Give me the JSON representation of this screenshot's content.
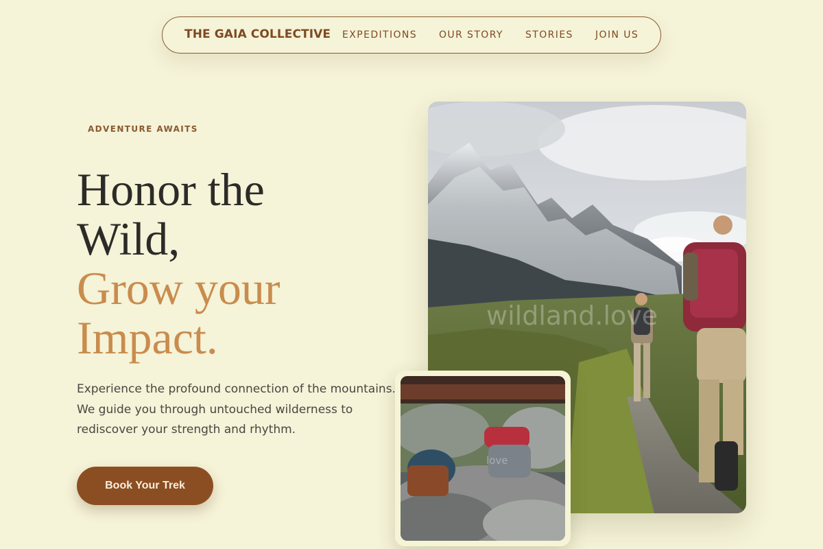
{
  "nav": {
    "brand": "THE GAIA COLLECTIVE",
    "links": [
      "EXPEDITIONS",
      "OUR STORY",
      "STORIES",
      "JOIN US"
    ]
  },
  "hero": {
    "eyebrow": "ADVENTURE AWAITS",
    "headline_dark": [
      "Honor the",
      "Wild,"
    ],
    "headline_accent": [
      "Grow your",
      "Impact."
    ],
    "lede": "Experience the profound connection of the mountains. We guide you through untouched wilderness to rediscover your strength and rhythm.",
    "cta_label": "Book Your Trek"
  },
  "images": {
    "main": {
      "subject": "hikers-on-mountain-trail",
      "watermark": "wildland.love"
    },
    "small": {
      "subject": "backpacks-on-rocks",
      "watermark": "love"
    }
  },
  "colors": {
    "background": "#f5f3d8",
    "brand": "#7e4a22",
    "accent": "#c98c4d",
    "button": "#8b4e23",
    "text": "#2d2b27"
  }
}
